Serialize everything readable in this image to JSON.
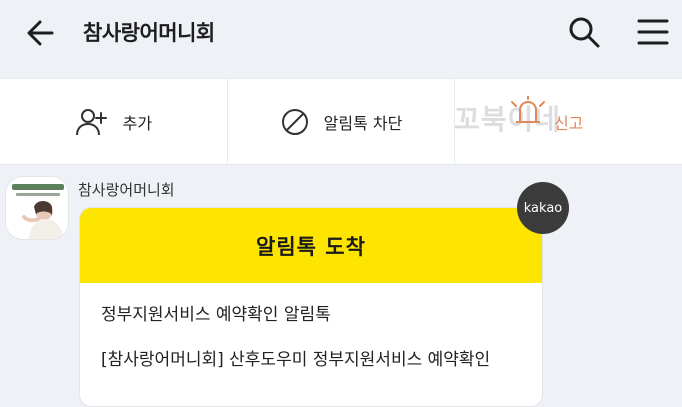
{
  "header": {
    "title": "참사랑어머니회",
    "back_icon": "arrow-left-icon",
    "search_icon": "search-icon",
    "menu_icon": "hamburger-menu-icon"
  },
  "actions": {
    "add_label": "추가",
    "block_label": "알림톡 차단",
    "report_label": "신고",
    "watermark": "꼬북이네"
  },
  "message": {
    "sender": "참사랑어머니회",
    "bubble_title": "알림톡 도착",
    "line1": "정부지원서비스 예약확인 알림톡",
    "line2": "[참사랑어머니회] 산후도우미 정부지원서비스 예약확인",
    "badge": "kakao"
  },
  "colors": {
    "background": "#eef1f6",
    "bubble_header": "#fee500",
    "badge": "#3b3b3b",
    "report_accent": "#e0885a"
  }
}
